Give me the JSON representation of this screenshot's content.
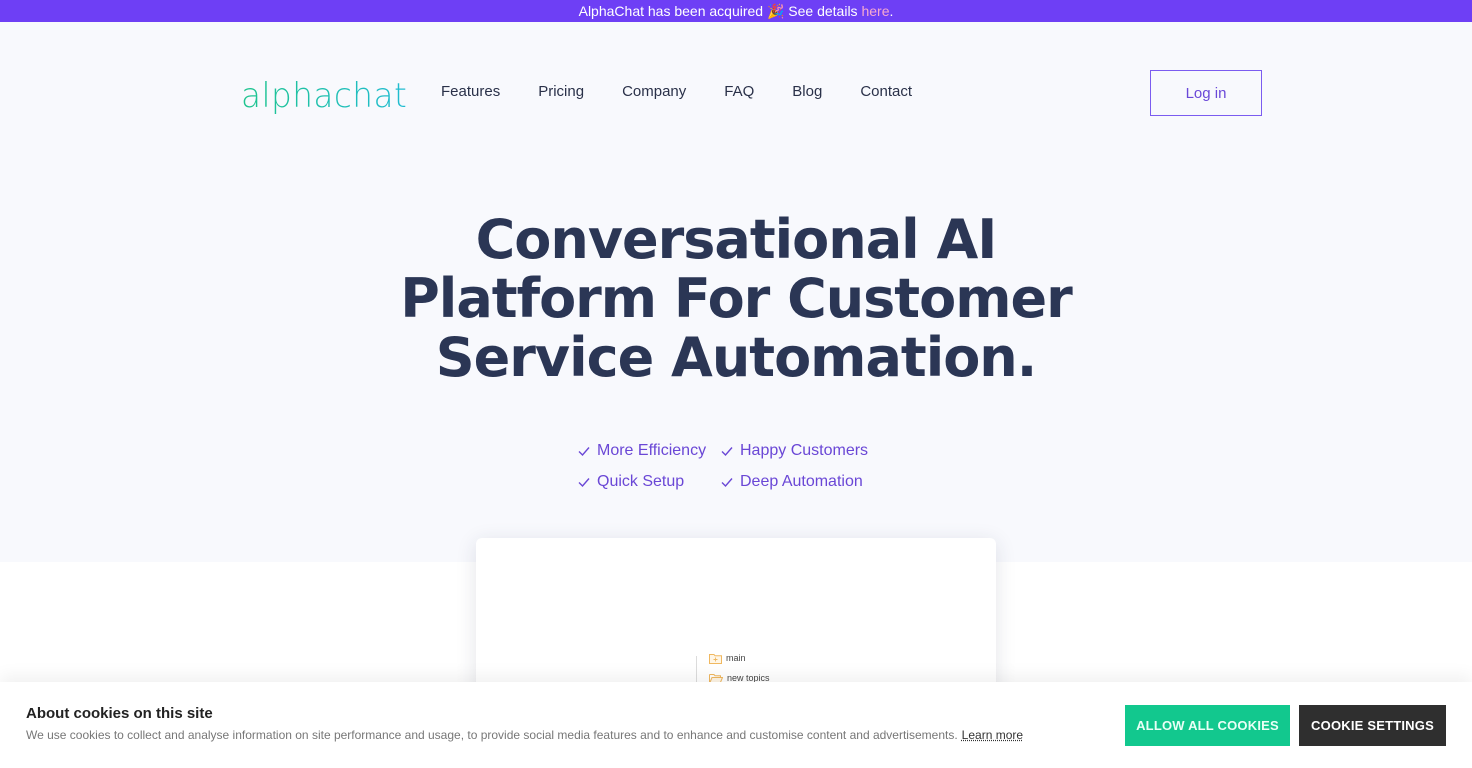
{
  "announcement": {
    "text": "AlphaChat has been acquired 🎉 See details ",
    "link_label": "here",
    "suffix": "."
  },
  "header": {
    "logo": "alphachat",
    "nav": [
      "Features",
      "Pricing",
      "Company",
      "FAQ",
      "Blog",
      "Contact"
    ],
    "login_label": "Log in"
  },
  "hero": {
    "headline_lines": [
      "Conversational AI",
      "Platform For Customer",
      "Service Automation."
    ],
    "benefits": [
      "More Efficiency",
      "Happy Customers",
      "Quick Setup",
      "Deep Automation"
    ]
  },
  "preview": {
    "tree": [
      "main",
      "new topics"
    ]
  },
  "cookie_banner": {
    "title": "About cookies on this site",
    "text": "We use cookies to collect and analyse information on site performance and usage, to provide social media features and to enhance and customise content and advertisements.",
    "learn_more": "Learn more",
    "allow_label": "ALLOW ALL COOKIES",
    "settings_label": "COOKIE SETTINGS"
  },
  "colors": {
    "accent": "#6e3ff5",
    "brand_green": "#12c88e",
    "headline": "#2b3655"
  }
}
